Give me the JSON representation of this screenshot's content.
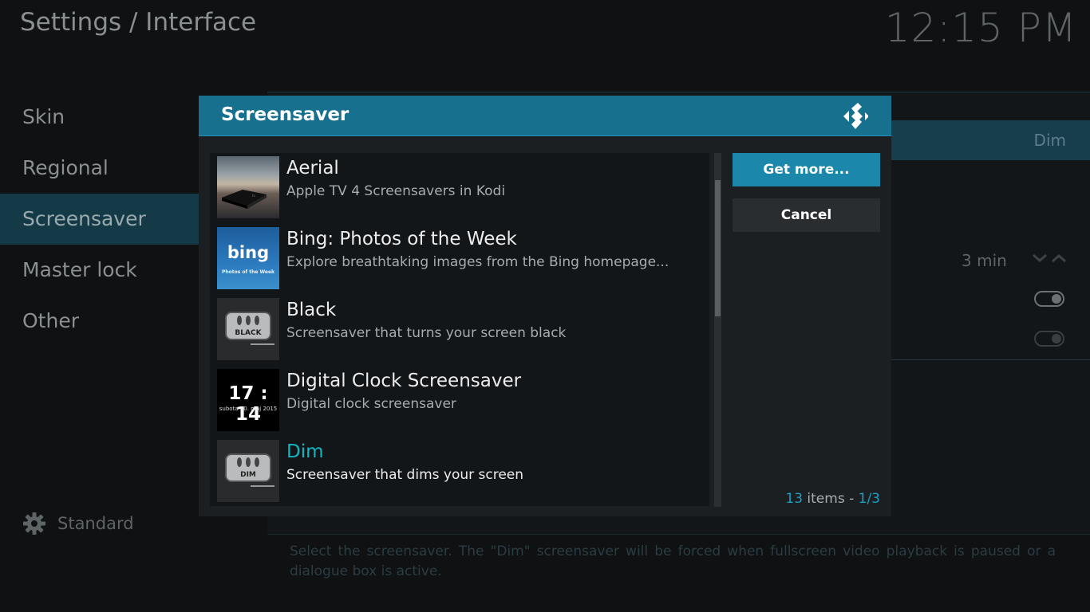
{
  "header": {
    "breadcrumb": "Settings / Interface",
    "clock": "12:15 PM"
  },
  "sidebar": {
    "items": [
      {
        "label": "Skin"
      },
      {
        "label": "Regional"
      },
      {
        "label": "Screensaver"
      },
      {
        "label": "Master lock"
      },
      {
        "label": "Other"
      }
    ],
    "settings_level": "Standard"
  },
  "background_settings": {
    "selected_value": "Dim",
    "wait_time": "3 min"
  },
  "description": "Select the screensaver. The \"Dim\" screensaver will be forced when fullscreen video playback is paused or a dialogue box is active.",
  "dialog": {
    "title": "Screensaver",
    "items": [
      {
        "label": "Aerial",
        "desc": "Apple TV 4 Screensavers in Kodi"
      },
      {
        "label": "Bing: Photos of the Week",
        "desc": "Explore breathtaking images from the Bing homepage..."
      },
      {
        "label": "Black",
        "desc": "Screensaver that turns your screen black"
      },
      {
        "label": "Digital Clock Screensaver",
        "desc": "Digital clock screensaver"
      },
      {
        "label": "Dim",
        "desc": "Screensaver that dims your screen"
      }
    ],
    "thumb_text": {
      "bing": "bing",
      "bing_sub": "Photos of the Week",
      "black": "BLACK",
      "dim": "DIM",
      "clock_time": "17 : 14",
      "clock_date": "subota 30. maj 2015"
    },
    "buttons": {
      "get_more": "Get more...",
      "cancel": "Cancel"
    },
    "count": {
      "total": "13",
      "items_word": " items - ",
      "page": "1/3"
    }
  },
  "colors": {
    "accent": "#16708e",
    "focus_text": "#12b5c2",
    "highlight": "#1b9fc4"
  }
}
